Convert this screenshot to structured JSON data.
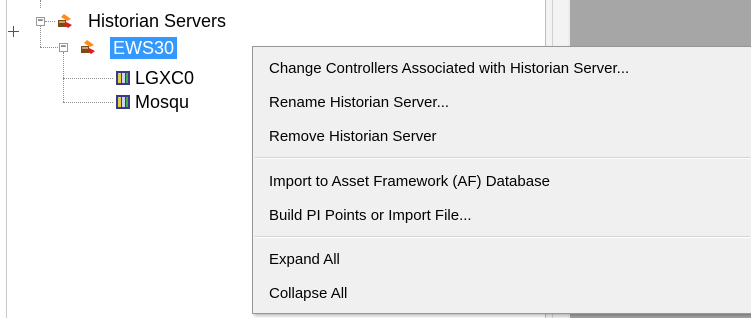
{
  "tree": {
    "root": {
      "label": "Historian Servers",
      "expander": "−"
    },
    "server": {
      "label": "EWS30",
      "expander": "−",
      "selected": true
    },
    "children": [
      {
        "label": "LGXC0"
      },
      {
        "label": "Mosqu"
      }
    ]
  },
  "context_menu": {
    "items": [
      {
        "label": "Change Controllers Associated with Historian Server..."
      },
      {
        "label": "Rename Historian Server..."
      },
      {
        "label": "Remove Historian Server"
      },
      {
        "label": "Import to Asset Framework (AF) Database"
      },
      {
        "label": "Build PI Points or Import File..."
      },
      {
        "label": "Expand All"
      },
      {
        "label": "Collapse All"
      }
    ]
  },
  "colors": {
    "selection": "#3399ff",
    "right_panel": "#a6a6a6",
    "menu_background": "#f0f0f0"
  },
  "icons": {
    "server": "historian-server-icon",
    "controller": "controller-icon"
  }
}
